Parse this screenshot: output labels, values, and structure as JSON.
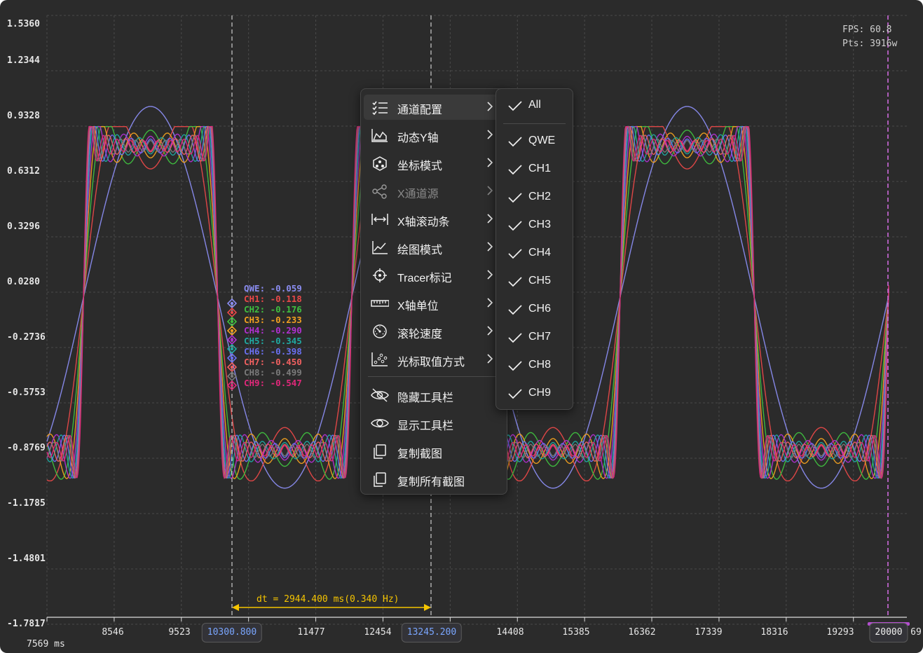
{
  "plot": {
    "y_ticks": [
      "1.5360",
      "1.2344",
      "0.9328",
      "0.6312",
      "0.3296",
      "0.0280",
      "-0.2736",
      "-0.5753",
      "-0.8769",
      "-1.1785",
      "-1.4801",
      "-1.7817"
    ],
    "x_ticks": [
      "8546",
      "9523",
      "11477",
      "12454",
      "14408",
      "15385",
      "16362",
      "17339",
      "18316",
      "19293"
    ],
    "x_unit_label": "7569 ms",
    "x_cut_label": "69",
    "cursor_a": "10300.800",
    "cursor_b": "13245.200",
    "x_end_marker": "20000",
    "dt_label": "dt = 2944.400 ms(0.340 Hz)",
    "fps": "FPS: 60.8",
    "pts": "Pts: 3916w",
    "accent_colors": {
      "cursor_line": "#bfbfbf",
      "end_line": "#d86ee8",
      "dt": "#f5c400",
      "cursor_text": "#7aa6ff",
      "background": "#2b2b2b"
    }
  },
  "chart_data": {
    "type": "line",
    "title": "",
    "xlabel": "ms",
    "ylabel": "",
    "xlim": [
      7569,
      20069
    ],
    "ylim": [
      -1.7817,
      1.536
    ],
    "grid": true,
    "waveform": "square wave of period ~3900 ms with overlapping harmonic ripple per channel",
    "series": [
      {
        "name": "QWE",
        "color": "#8a8cf0"
      },
      {
        "name": "CH1",
        "color": "#e84848"
      },
      {
        "name": "CH2",
        "color": "#3fbf3f"
      },
      {
        "name": "CH3",
        "color": "#f0a020"
      },
      {
        "name": "CH4",
        "color": "#b030d0"
      },
      {
        "name": "CH5",
        "color": "#20a8a0"
      },
      {
        "name": "CH6",
        "color": "#6a70f0"
      },
      {
        "name": "CH7",
        "color": "#f06060"
      },
      {
        "name": "CH8",
        "color": "#7a7a7a"
      },
      {
        "name": "CH9",
        "color": "#e0287a"
      }
    ]
  },
  "tracer": {
    "items": [
      {
        "name": "QWE",
        "value": "-0.059",
        "color": "#8a8cf0"
      },
      {
        "name": "CH1",
        "value": "-0.118",
        "color": "#e84848"
      },
      {
        "name": "CH2",
        "value": "-0.176",
        "color": "#3fbf3f"
      },
      {
        "name": "CH3",
        "value": "-0.233",
        "color": "#f0a020"
      },
      {
        "name": "CH4",
        "value": "-0.290",
        "color": "#b030d0"
      },
      {
        "name": "CH5",
        "value": "-0.345",
        "color": "#20a8a0"
      },
      {
        "name": "CH6",
        "value": "-0.398",
        "color": "#6a70f0"
      },
      {
        "name": "CH7",
        "value": "-0.450",
        "color": "#f06060"
      },
      {
        "name": "CH8",
        "value": "-0.499",
        "color": "#7a7a7a"
      },
      {
        "name": "CH9",
        "value": "-0.547",
        "color": "#e0287a"
      }
    ]
  },
  "context_menu": {
    "items": [
      {
        "label": "通道配置",
        "icon": "channel-list-icon",
        "submenu": true,
        "hover": true
      },
      {
        "label": "动态Y轴",
        "icon": "area-chart-icon",
        "submenu": true
      },
      {
        "label": "坐标模式",
        "icon": "coordinate-icon",
        "submenu": true
      },
      {
        "label": "X通道源",
        "icon": "share-icon",
        "submenu": true,
        "disabled": true
      },
      {
        "label": "X轴滚动条",
        "icon": "horizontal-arrows-icon",
        "submenu": true
      },
      {
        "label": "绘图模式",
        "icon": "line-chart-icon",
        "submenu": true
      },
      {
        "label": "Tracer标记",
        "icon": "crosshair-icon",
        "submenu": true
      },
      {
        "label": "X轴单位",
        "icon": "ruler-icon",
        "submenu": true
      },
      {
        "label": "滚轮速度",
        "icon": "gauge-icon",
        "submenu": true
      },
      {
        "label": "光标取值方式",
        "icon": "scatter-icon",
        "submenu": true
      },
      {
        "label": "隐藏工具栏",
        "icon": "eye-off-icon",
        "submenu": false
      },
      {
        "label": "显示工具栏",
        "icon": "eye-icon",
        "submenu": false
      },
      {
        "label": "复制截图",
        "icon": "copy-icon",
        "submenu": false
      },
      {
        "label": "复制所有截图",
        "icon": "copy-all-icon",
        "submenu": false
      }
    ]
  },
  "channel_submenu": {
    "all_label": "All",
    "items": [
      "QWE",
      "CH1",
      "CH2",
      "CH3",
      "CH4",
      "CH5",
      "CH6",
      "CH7",
      "CH8",
      "CH9"
    ]
  }
}
